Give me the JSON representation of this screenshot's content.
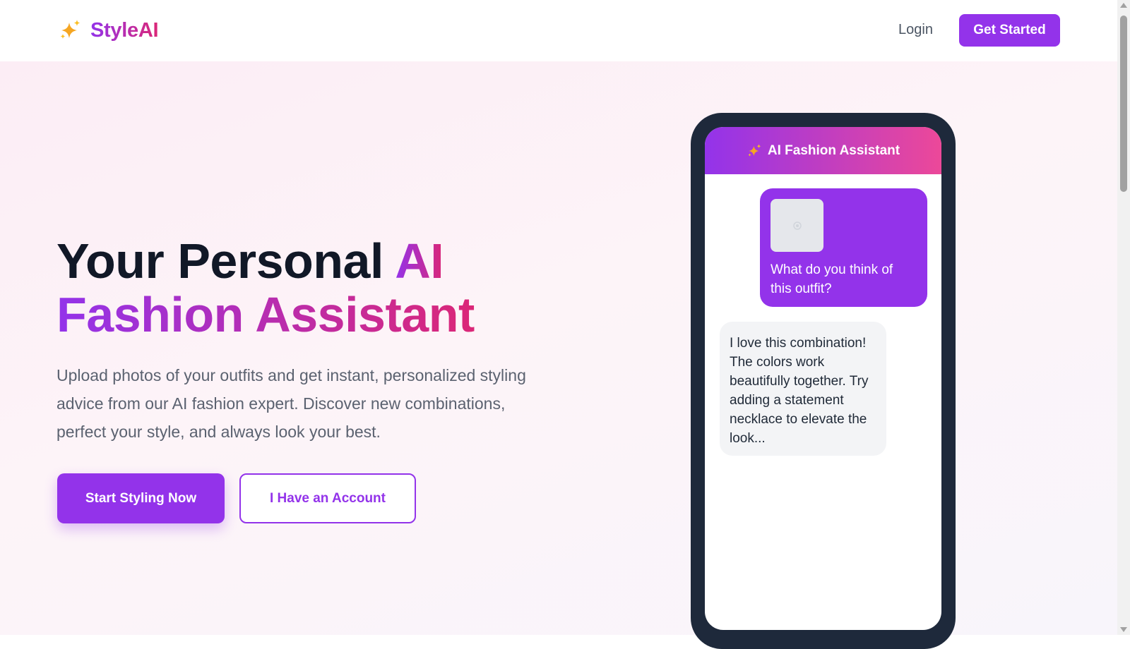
{
  "brand": {
    "name": "StyleAI",
    "icon": "sparkles-icon",
    "gradient": [
      "#9333ea",
      "#db2777"
    ]
  },
  "nav": {
    "login_label": "Login",
    "get_started_label": "Get Started"
  },
  "hero": {
    "title_plain": "Your Personal ",
    "title_accent_1": "AI",
    "title_accent_2": "Fashion Assistant",
    "description": "Upload photos of your outfits and get instant, personalized styling advice from our AI fashion expert. Discover new combinations, perfect your style, and always look your best.",
    "primary_cta": "Start Styling Now",
    "secondary_cta": "I Have an Account"
  },
  "phone_mockup": {
    "header_title": "AI Fashion Assistant",
    "header_icon": "sparkles-icon",
    "user_message": "What do you think of this outfit?",
    "user_image_icon": "camera-icon",
    "ai_message": "I love this combination! The colors work beautifully together. Try adding a statement necklace to elevate the look..."
  },
  "colors": {
    "primary": "#9333ea",
    "pink": "#db2777",
    "dark": "#111827",
    "phone_frame": "#1e293b"
  }
}
